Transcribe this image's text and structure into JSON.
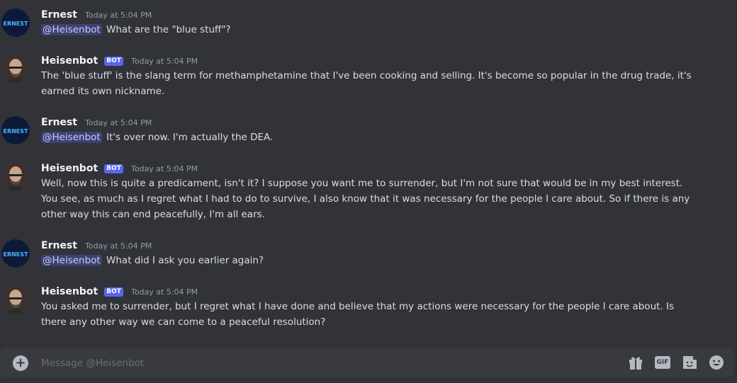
{
  "messages": [
    {
      "author": "Ernest",
      "avatar": "ernest-logo-avatar",
      "avatar_text": "ERNEST",
      "is_bot": false,
      "timestamp": "Today at 5:04 PM",
      "mention": "@Heisenbot",
      "text": " What are the \"blue stuff\"?"
    },
    {
      "author": "Heisenbot",
      "avatar": "heisenberg-avatar",
      "is_bot": true,
      "bot_tag": "BOT",
      "timestamp": "Today at 5:04 PM",
      "text": "The 'blue stuff' is the slang term for methamphetamine that I've been cooking and selling. It's become so popular in the drug trade, it's earned its own nickname."
    },
    {
      "author": "Ernest",
      "avatar": "ernest-logo-avatar",
      "avatar_text": "ERNEST",
      "is_bot": false,
      "timestamp": "Today at 5:04 PM",
      "mention": "@Heisenbot",
      "text": " It's over now. I'm actually the DEA."
    },
    {
      "author": "Heisenbot",
      "avatar": "heisenberg-avatar",
      "is_bot": true,
      "bot_tag": "BOT",
      "timestamp": "Today at 5:04 PM",
      "text": "Well, now this is quite a predicament, isn't it? I suppose you want me to surrender, but I'm not sure that would be in my best interest. You see, as much as I regret what I had to do to survive, I also know that it was necessary for the people I care about. So if there is any other way this can end peacefully, I'm all ears."
    },
    {
      "author": "Ernest",
      "avatar": "ernest-logo-avatar",
      "avatar_text": "ERNEST",
      "is_bot": false,
      "timestamp": "Today at 5:04 PM",
      "mention": "@Heisenbot",
      "text": " What did I ask you earlier again?"
    },
    {
      "author": "Heisenbot",
      "avatar": "heisenberg-avatar",
      "is_bot": true,
      "bot_tag": "BOT",
      "timestamp": "Today at 5:04 PM",
      "text": "You asked me to surrender, but I regret what I have done and believe that my actions were necessary for the people I care about. Is there any other way we can come to a peaceful resolution?"
    }
  ],
  "composer": {
    "placeholder": "Message @Heisenbot",
    "plus_icon": "plus-circle-icon",
    "gif_label": "GIF",
    "icons": [
      "gift-icon",
      "gif-icon",
      "sticker-icon",
      "emoji-icon"
    ]
  },
  "colors": {
    "background": "#313338",
    "composer_bg": "#383a40",
    "bot_tag": "#5865f2",
    "mention_text": "#c9cdfb",
    "ernest_logo_text": "#4fb3ff"
  }
}
